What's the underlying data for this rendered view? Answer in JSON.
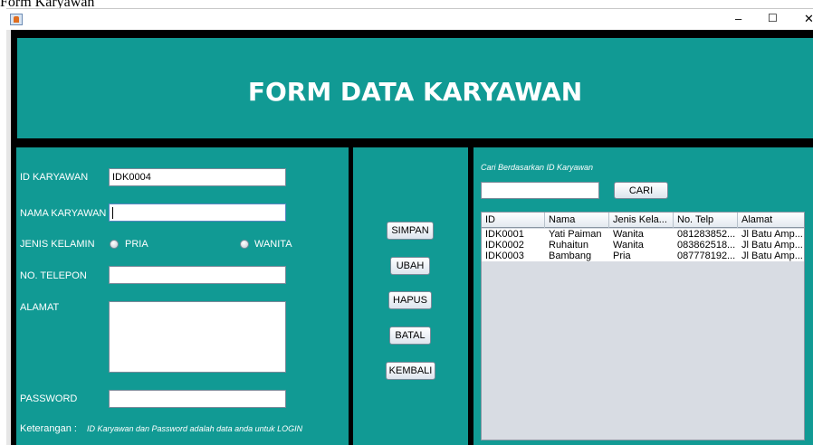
{
  "window": {
    "caption": "Form Karyawan",
    "controls": {
      "minimize": "–",
      "maximize": "☐",
      "close": "✕"
    }
  },
  "header": {
    "title": "FORM DATA KARYAWAN"
  },
  "form": {
    "id_label": "ID KARYAWAN",
    "id_value": "IDK0004",
    "nama_label": "NAMA KARYAWAN",
    "nama_value": "",
    "jk_label": "JENIS KELAMIN",
    "pria_label": "PRIA",
    "wanita_label": "WANITA",
    "telp_label": "NO. TELEPON",
    "telp_value": "",
    "alamat_label": "ALAMAT",
    "alamat_value": "",
    "password_label": "PASSWORD",
    "password_value": "",
    "keterangan_label": "Keterangan :",
    "keterangan_text": "ID Karyawan dan Password adalah data anda untuk LOGIN"
  },
  "buttons": {
    "simpan": "SIMPAN",
    "ubah": "UBAH",
    "hapus": "HAPUS",
    "batal": "BATAL",
    "kembali": "KEMBALI"
  },
  "search": {
    "label": "Cari Berdasarkan ID Karyawan",
    "value": "",
    "button": "CARI"
  },
  "table": {
    "columns": [
      "ID",
      "Nama",
      "Jenis Kela...",
      "No. Telp",
      "Alamat"
    ],
    "rows": [
      [
        "IDK0001",
        "Yati Paiman",
        "Wanita",
        "081283852...",
        "Jl Batu Amp..."
      ],
      [
        "IDK0002",
        "Ruhaitun",
        "Wanita",
        "083862518...",
        "Jl Batu Amp..."
      ],
      [
        "IDK0003",
        "Bambang",
        "Pria",
        "087778192...",
        "Jl Batu Amp..."
      ]
    ]
  },
  "colors": {
    "teal": "#119a94",
    "frame": "#000000"
  }
}
